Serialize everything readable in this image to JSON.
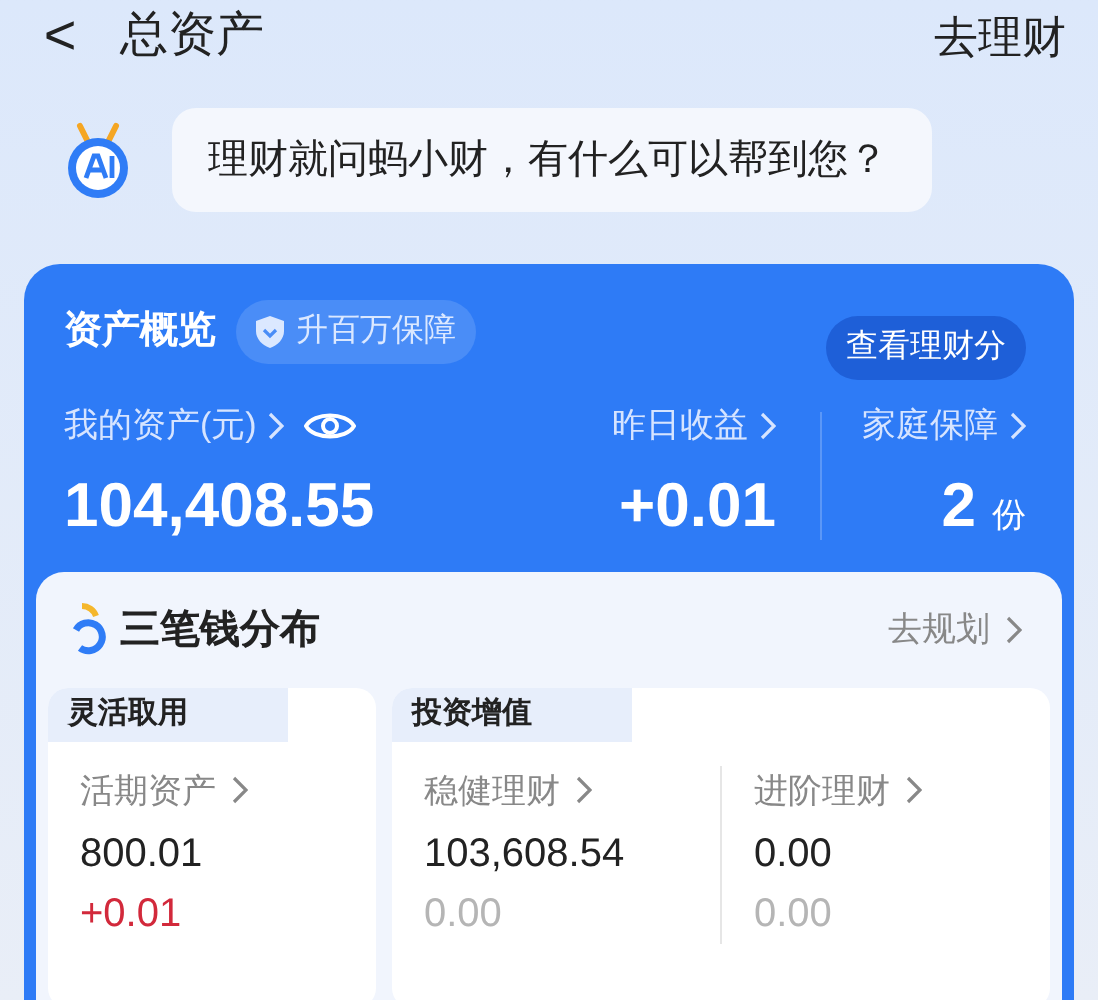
{
  "header": {
    "back": "<",
    "title": "总资产",
    "action": "去理财"
  },
  "assistant": {
    "message": "理财就问蚂小财，有什么可以帮到您？"
  },
  "overview": {
    "title": "资产概览",
    "badge": "升百万保障",
    "score_button": "查看理财分",
    "my_assets": {
      "label": "我的资产(元)",
      "amount": "104,408.55"
    },
    "yesterday": {
      "label": "昨日收益",
      "amount": "+0.01"
    },
    "family": {
      "label": "家庭保障",
      "amount": "2",
      "unit": "份"
    }
  },
  "distribution": {
    "title": "三笔钱分布",
    "link": "去规划",
    "groups": [
      {
        "title": "灵活取用",
        "items": [
          {
            "label": "活期资产",
            "amount": "800.01",
            "change": "+0.01",
            "color": "#d2293b"
          }
        ]
      },
      {
        "title": "投资增值",
        "items": [
          {
            "label": "稳健理财",
            "amount": "103,608.54",
            "change": "0.00",
            "color": "#b5b5b5"
          },
          {
            "label": "进阶理财",
            "amount": "0.00",
            "change": "0.00",
            "color": "#b5b5b5"
          }
        ]
      }
    ]
  }
}
